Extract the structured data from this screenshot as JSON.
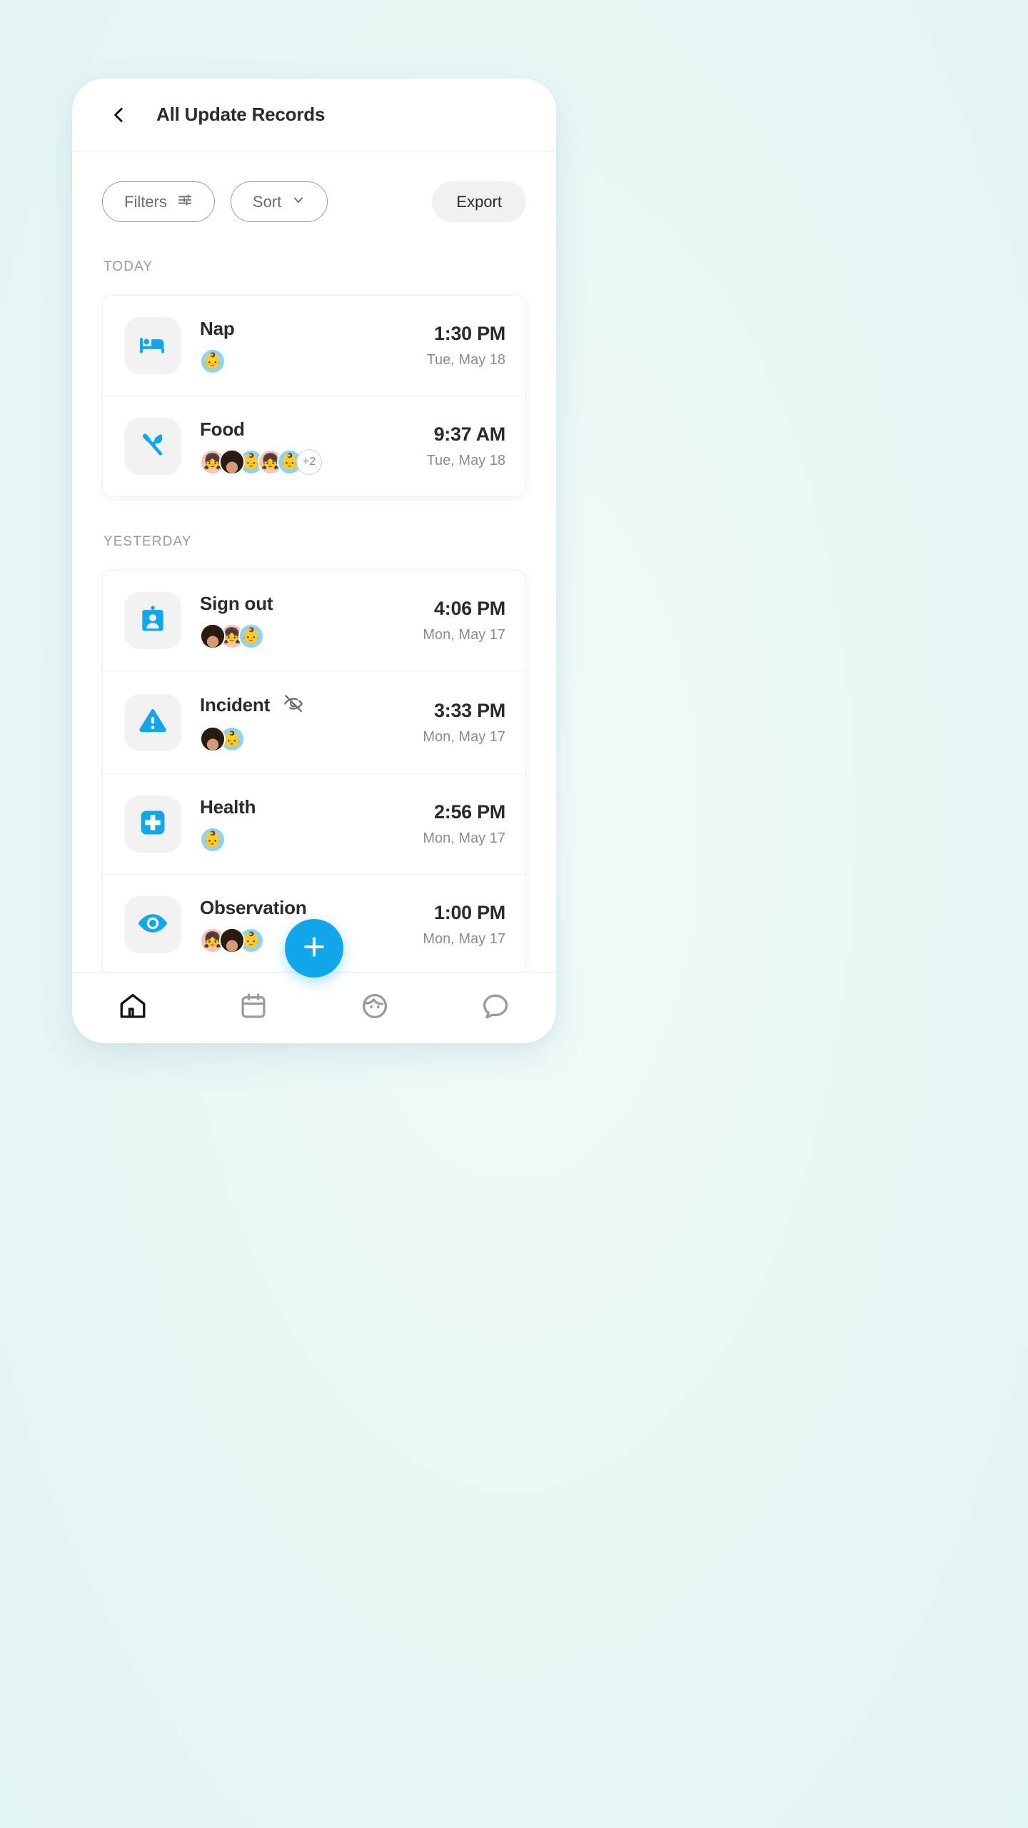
{
  "app": {
    "header": {
      "back_icon": "chevron-left-icon",
      "title": "All Update Records"
    },
    "toolbar": {
      "filters_label": "Filters",
      "filters_icon": "tune-sliders-icon",
      "sort_label": "Sort",
      "sort_icon": "chevron-down-icon",
      "export_label": "Export"
    },
    "sections": [
      {
        "label": "TODAY",
        "rows": [
          {
            "title": "Nap",
            "icon": "bed-icon",
            "hidden_icon": null,
            "time": "1:30 PM",
            "date": "Tue, May 18",
            "avatars": [
              "baby-blue"
            ],
            "more_count": null
          },
          {
            "title": "Food",
            "icon": "utensils-icon",
            "hidden_icon": null,
            "time": "9:37 AM",
            "date": "Tue, May 18",
            "avatars": [
              "girl-pink",
              "photo",
              "baby-blue",
              "girl-pink",
              "baby-blue"
            ],
            "more_count": "+2"
          }
        ]
      },
      {
        "label": "YESTERDAY",
        "rows": [
          {
            "title": "Sign out",
            "icon": "id-badge-icon",
            "hidden_icon": null,
            "time": "4:06 PM",
            "date": "Mon, May 17",
            "avatars": [
              "photo",
              "girl-pink",
              "baby-blue"
            ],
            "more_count": null
          },
          {
            "title": "Incident",
            "icon": "warning-triangle-icon",
            "hidden_icon": "eye-off-icon",
            "time": "3:33 PM",
            "date": "Mon, May 17",
            "avatars": [
              "photo",
              "baby-blue"
            ],
            "more_count": null
          },
          {
            "title": "Health",
            "icon": "medical-cross-icon",
            "hidden_icon": null,
            "time": "2:56 PM",
            "date": "Mon, May 17",
            "avatars": [
              "baby-blue"
            ],
            "more_count": null
          },
          {
            "title": "Observation",
            "icon": "eye-icon",
            "hidden_icon": null,
            "time": "1:00 PM",
            "date": "Mon, May 17",
            "avatars": [
              "girl-pink",
              "photo",
              "baby-blue"
            ],
            "more_count": null
          }
        ]
      }
    ],
    "fab": {
      "icon": "plus-icon"
    },
    "bottom_nav": [
      {
        "icon": "home-icon",
        "active": true
      },
      {
        "icon": "calendar-icon",
        "active": false
      },
      {
        "icon": "child-face-icon",
        "active": false
      },
      {
        "icon": "chat-bubble-icon",
        "active": false
      }
    ],
    "colors": {
      "accent": "#11a7ea",
      "page_background": "#e9f7f7",
      "text_primary": "#2b2b2b",
      "text_muted": "#8d8d8d"
    }
  }
}
